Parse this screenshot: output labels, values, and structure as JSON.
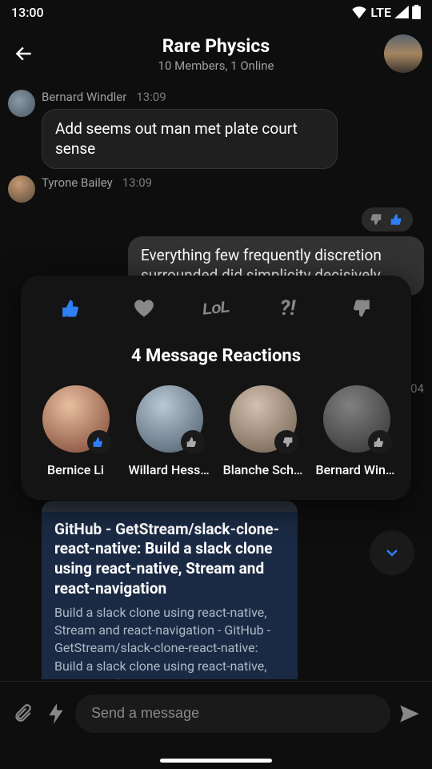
{
  "status": {
    "time": "13:00",
    "network": "LTE"
  },
  "header": {
    "title": "Rare Physics",
    "subtitle": "10 Members, 1 Online"
  },
  "messages": {
    "m1": {
      "author": "Bernard Windler",
      "time": "13:09",
      "text": "Add seems out man met plate court sense"
    },
    "m2": {
      "author": "Tyrone Bailey",
      "time": "13:09"
    },
    "own1": {
      "text": "Everything few frequently discretion surrounded did simplicity decisively"
    },
    "peek_time": "04",
    "link": {
      "title": "GitHub - GetStream/slack-clone-react-native: Build a slack clone using react-native, Stream and react-navigation",
      "desc": "Build a slack clone using react-native, Stream and react-navigation - GitHub - GetStream/slack-clone-react-native: Build a slack clone using react-native, Stream and react-navigation"
    }
  },
  "reactions_sheet": {
    "title": "4 Message Reactions",
    "options": {
      "lol": "LoL",
      "wut": "?!"
    },
    "reactors": [
      {
        "name": "Bernice Li"
      },
      {
        "name": "Willard Hessel"
      },
      {
        "name": "Blanche Sch…"
      },
      {
        "name": "Bernard Wind…"
      }
    ]
  },
  "composer": {
    "placeholder": "Send a message"
  }
}
